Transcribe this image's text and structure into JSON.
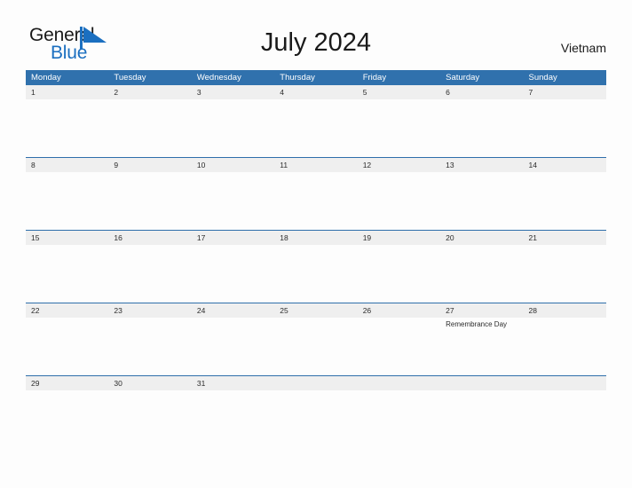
{
  "brand": {
    "word_one": "General",
    "word_two": "Blue",
    "flag_icon": "blue-triangle-flag-icon",
    "accent_color": "#1b6fc0"
  },
  "header": {
    "title": "July 2024",
    "country": "Vietnam"
  },
  "theme": {
    "header_blue": "#3071ad",
    "row_divider_blue": "#2f6fab",
    "date_band_gray": "#efefef",
    "page_background": "#fdfdfd",
    "text_dark": "#2b2b2b"
  },
  "calendar": {
    "weekdays": [
      "Monday",
      "Tuesday",
      "Wednesday",
      "Thursday",
      "Friday",
      "Saturday",
      "Sunday"
    ],
    "weeks": [
      {
        "days": [
          {
            "date": "1",
            "events": []
          },
          {
            "date": "2",
            "events": []
          },
          {
            "date": "3",
            "events": []
          },
          {
            "date": "4",
            "events": []
          },
          {
            "date": "5",
            "events": []
          },
          {
            "date": "6",
            "events": []
          },
          {
            "date": "7",
            "events": []
          }
        ]
      },
      {
        "days": [
          {
            "date": "8",
            "events": []
          },
          {
            "date": "9",
            "events": []
          },
          {
            "date": "10",
            "events": []
          },
          {
            "date": "11",
            "events": []
          },
          {
            "date": "12",
            "events": []
          },
          {
            "date": "13",
            "events": []
          },
          {
            "date": "14",
            "events": []
          }
        ]
      },
      {
        "days": [
          {
            "date": "15",
            "events": []
          },
          {
            "date": "16",
            "events": []
          },
          {
            "date": "17",
            "events": []
          },
          {
            "date": "18",
            "events": []
          },
          {
            "date": "19",
            "events": []
          },
          {
            "date": "20",
            "events": []
          },
          {
            "date": "21",
            "events": []
          }
        ]
      },
      {
        "days": [
          {
            "date": "22",
            "events": []
          },
          {
            "date": "23",
            "events": []
          },
          {
            "date": "24",
            "events": []
          },
          {
            "date": "25",
            "events": []
          },
          {
            "date": "26",
            "events": []
          },
          {
            "date": "27",
            "events": [
              "Remembrance Day"
            ]
          },
          {
            "date": "28",
            "events": []
          }
        ]
      },
      {
        "days": [
          {
            "date": "29",
            "events": []
          },
          {
            "date": "30",
            "events": []
          },
          {
            "date": "31",
            "events": []
          },
          {
            "date": "",
            "events": []
          },
          {
            "date": "",
            "events": []
          },
          {
            "date": "",
            "events": []
          },
          {
            "date": "",
            "events": []
          }
        ]
      }
    ]
  }
}
